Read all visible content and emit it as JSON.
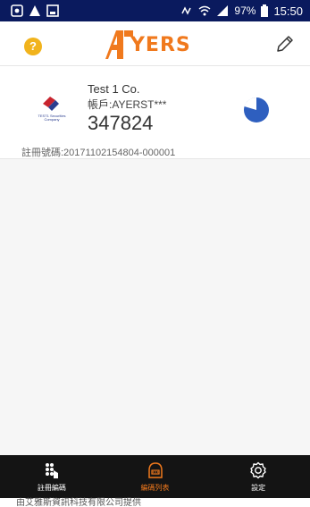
{
  "status_bar": {
    "battery": "97%",
    "time": "15:50"
  },
  "header": {
    "help_label": "?",
    "logo_text": "YERS",
    "logo_icon": "ayers-logo-icon",
    "edit_icon": "pencil-icon"
  },
  "account": {
    "company_name": "Test 1 Co.",
    "account_line": "帳戶:AYERST***",
    "code": "347824",
    "registration": "註冊號碼:20171102154804-000001",
    "company_logo_caption": "TEST1 Securities Company"
  },
  "nav": {
    "items": [
      {
        "label": "註冊編碼",
        "icon": "register-icon"
      },
      {
        "label": "編碼列表",
        "icon": "list-icon"
      },
      {
        "label": "設定",
        "icon": "gear-icon"
      }
    ]
  },
  "footer": {
    "text": "由艾雅斯資訊科技有限公司提供"
  },
  "colors": {
    "accent": "#f0791d",
    "status_bar": "#0a1a5e",
    "pie_blue": "#2e5fbf",
    "help_yellow": "#f1b31c"
  }
}
